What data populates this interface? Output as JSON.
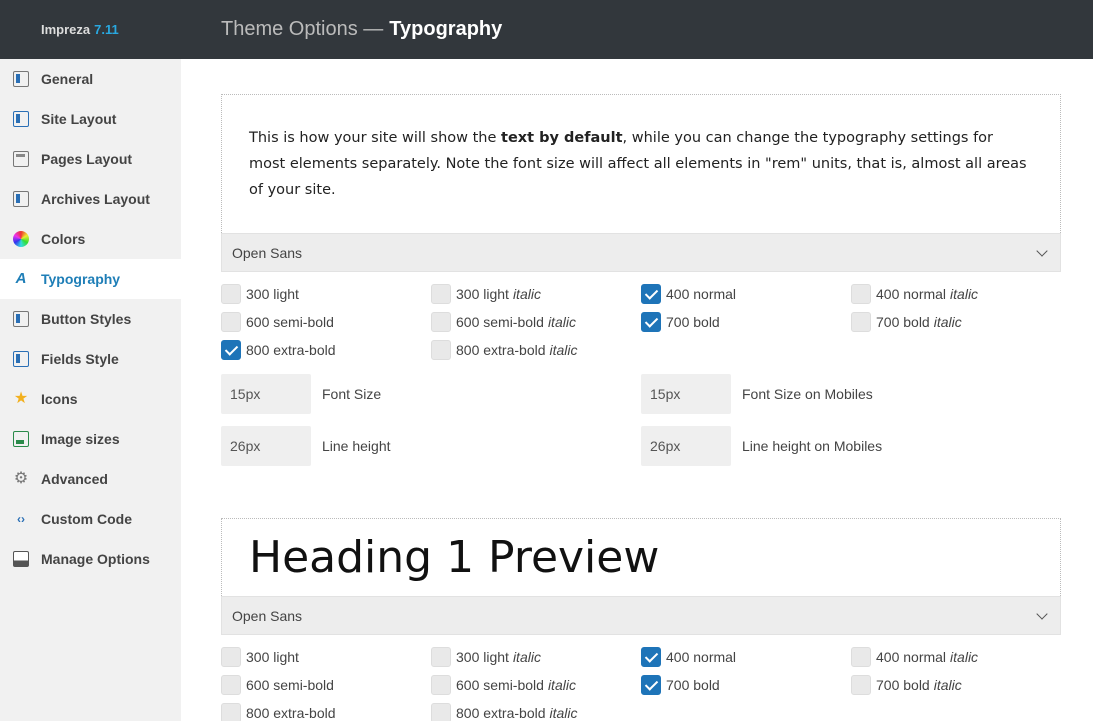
{
  "brand": {
    "name": "Impreza",
    "version": "7.11"
  },
  "header": {
    "prefix": "Theme Options —",
    "title": "Typography"
  },
  "sidebar": {
    "items": [
      {
        "label": "General",
        "icon": "sliders-icon"
      },
      {
        "label": "Site Layout",
        "icon": "layout-icon"
      },
      {
        "label": "Pages Layout",
        "icon": "page-layout-icon"
      },
      {
        "label": "Archives Layout",
        "icon": "archive-icon"
      },
      {
        "label": "Colors",
        "icon": "color-wheel-icon"
      },
      {
        "label": "Typography",
        "icon": "typography-icon",
        "active": true
      },
      {
        "label": "Button Styles",
        "icon": "button-icon"
      },
      {
        "label": "Fields Style",
        "icon": "fields-icon"
      },
      {
        "label": "Icons",
        "icon": "star-icon"
      },
      {
        "label": "Image sizes",
        "icon": "image-icon"
      },
      {
        "label": "Advanced",
        "icon": "gear-icon"
      },
      {
        "label": "Custom Code",
        "icon": "code-icon"
      },
      {
        "label": "Manage Options",
        "icon": "drive-icon"
      }
    ]
  },
  "body_text": {
    "preview_pre": "This is how your site will show the ",
    "preview_bold": "text by default",
    "preview_post": ", while you can change the typography settings for most elements separately. Note the font size will affect all elements in \"rem\" units, that is, almost all areas of your site.",
    "font": "Open Sans",
    "weights": [
      {
        "label": "300 light",
        "italic": "",
        "checked": false
      },
      {
        "label": "300 light",
        "italic": "italic",
        "checked": false
      },
      {
        "label": "400 normal",
        "italic": "",
        "checked": true
      },
      {
        "label": "400 normal",
        "italic": "italic",
        "checked": false
      },
      {
        "label": "600 semi-bold",
        "italic": "",
        "checked": false
      },
      {
        "label": "600 semi-bold",
        "italic": "italic",
        "checked": false
      },
      {
        "label": "700 bold",
        "italic": "",
        "checked": true
      },
      {
        "label": "700 bold",
        "italic": "italic",
        "checked": false
      },
      {
        "label": "800 extra-bold",
        "italic": "",
        "checked": true
      },
      {
        "label": "800 extra-bold",
        "italic": "italic",
        "checked": false
      }
    ],
    "fields": [
      {
        "value": "15px",
        "label": "Font Size"
      },
      {
        "value": "15px",
        "label": "Font Size on Mobiles"
      },
      {
        "value": "26px",
        "label": "Line height"
      },
      {
        "value": "26px",
        "label": "Line height on Mobiles"
      }
    ]
  },
  "heading1": {
    "preview": "Heading 1 Preview",
    "font": "Open Sans",
    "weights": [
      {
        "label": "300 light",
        "italic": "",
        "checked": false
      },
      {
        "label": "300 light",
        "italic": "italic",
        "checked": false
      },
      {
        "label": "400 normal",
        "italic": "",
        "checked": true
      },
      {
        "label": "400 normal",
        "italic": "italic",
        "checked": false
      },
      {
        "label": "600 semi-bold",
        "italic": "",
        "checked": false
      },
      {
        "label": "600 semi-bold",
        "italic": "italic",
        "checked": false
      },
      {
        "label": "700 bold",
        "italic": "",
        "checked": true
      },
      {
        "label": "700 bold",
        "italic": "italic",
        "checked": false
      },
      {
        "label": "800 extra-bold",
        "italic": "",
        "checked": false
      },
      {
        "label": "800 extra-bold",
        "italic": "italic",
        "checked": false
      }
    ]
  },
  "colors": {
    "accent": "#1e7eb7",
    "header_bg": "#32373c",
    "version": "#29a8e0"
  }
}
